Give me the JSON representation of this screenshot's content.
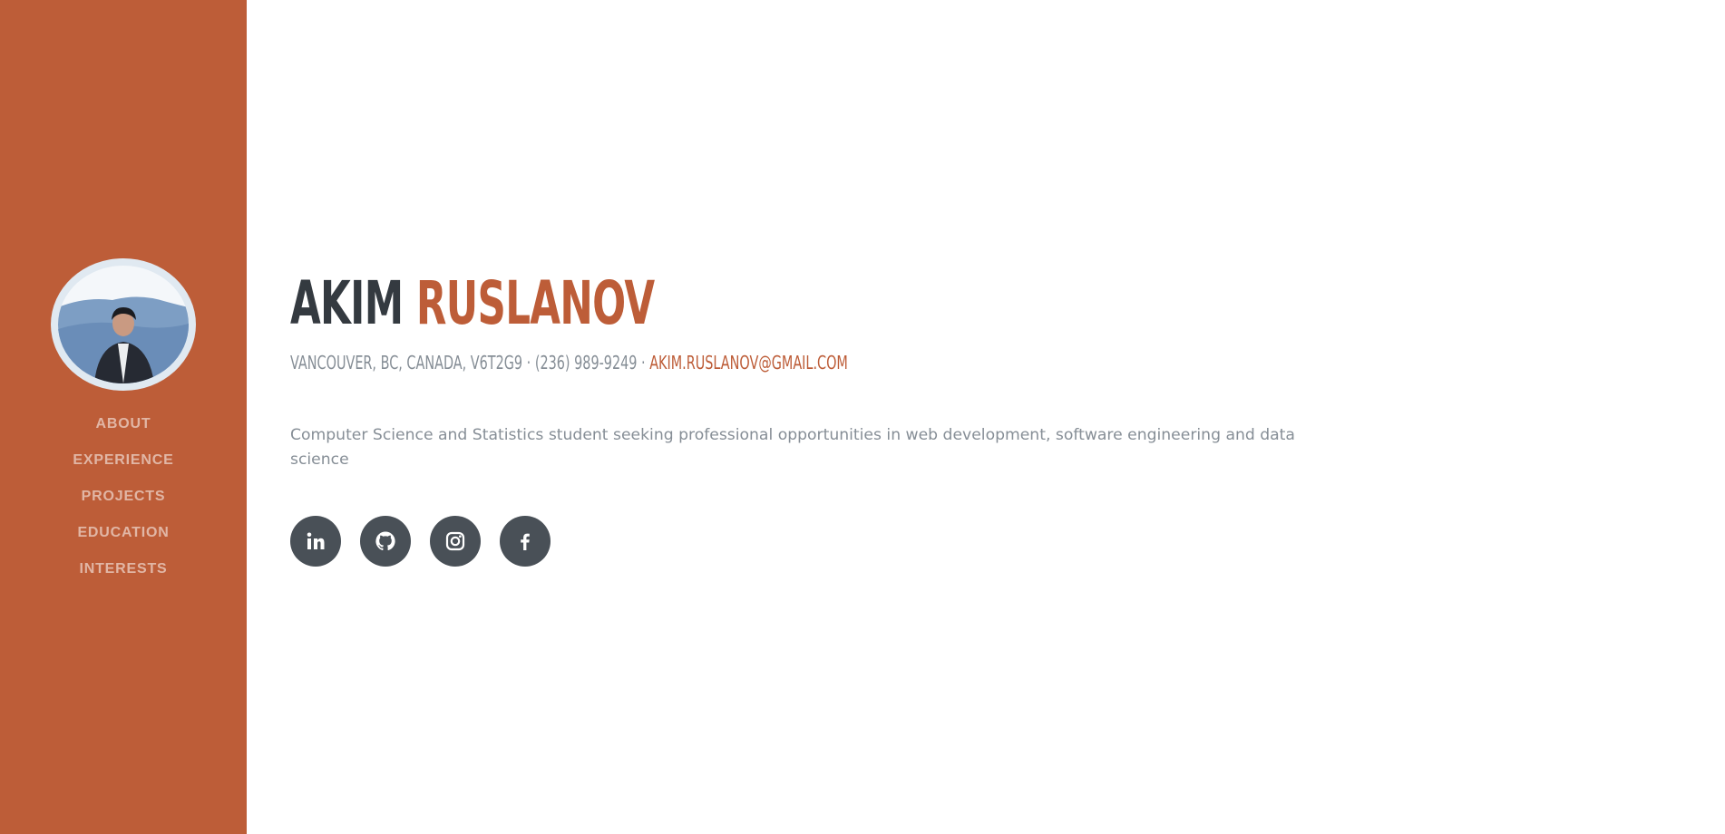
{
  "sidebar": {
    "nav": [
      {
        "label": "About"
      },
      {
        "label": "Experience"
      },
      {
        "label": "Projects"
      },
      {
        "label": "Education"
      },
      {
        "label": "Interests"
      }
    ],
    "accent_color": "#bd5d38"
  },
  "header": {
    "first_name": "Akim",
    "last_name": "Ruslanov",
    "location": "Vancouver, BC, Canada, V6T2G9",
    "separator": "·",
    "phone": "(236) 989-9249",
    "email": "akim.ruslanov@gmail.com"
  },
  "summary": "Computer Science and Statistics student seeking professional opportunities in web development, software engineering and data science",
  "social": [
    {
      "icon": "linkedin-icon"
    },
    {
      "icon": "github-icon"
    },
    {
      "icon": "instagram-icon"
    },
    {
      "icon": "facebook-icon"
    }
  ]
}
